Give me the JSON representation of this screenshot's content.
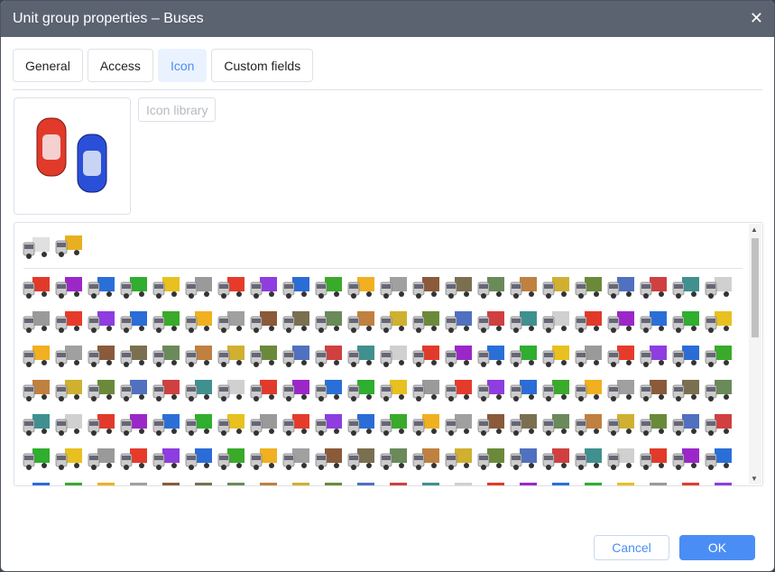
{
  "title": "Unit group properties – Buses",
  "tabs": [
    {
      "label": "General"
    },
    {
      "label": "Access"
    },
    {
      "label": "Icon"
    },
    {
      "label": "Custom fields"
    }
  ],
  "active_tab": "Icon",
  "icon_library_label": "Icon library",
  "buttons": {
    "cancel": "Cancel",
    "ok": "OK"
  },
  "colors": {
    "accent": "#4a8ef5",
    "header": "#5b6270"
  },
  "icon_palette": [
    "#e23a2a",
    "#9b27c9",
    "#2a6fd8",
    "#2fae2f",
    "#e8c020",
    "#9a9a9a",
    "#e63b2b",
    "#8e3de0",
    "#2b6cd6",
    "#3aaa2a",
    "#f0b020",
    "#a0a0a0",
    "#8a5a3a",
    "#7a7050",
    "#6a8a5a",
    "#c08040",
    "#d0b030",
    "#6a8a3a",
    "#5070c0",
    "#d04040",
    "#409090",
    "#d0d0d0"
  ]
}
